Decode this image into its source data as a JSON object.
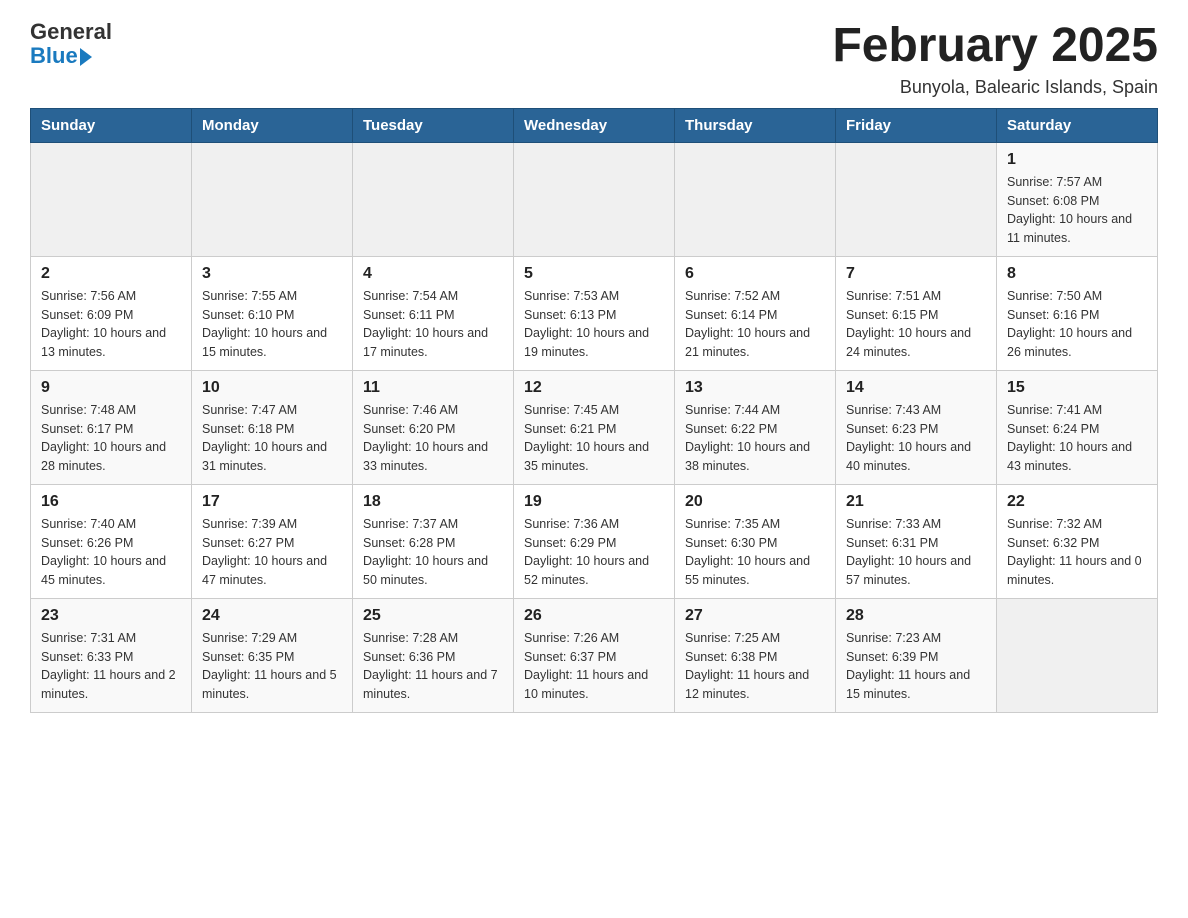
{
  "header": {
    "logo_general": "General",
    "logo_blue": "Blue",
    "month_title": "February 2025",
    "location": "Bunyola, Balearic Islands, Spain"
  },
  "days_of_week": [
    "Sunday",
    "Monday",
    "Tuesday",
    "Wednesday",
    "Thursday",
    "Friday",
    "Saturday"
  ],
  "weeks": [
    {
      "days": [
        {
          "number": "",
          "info": ""
        },
        {
          "number": "",
          "info": ""
        },
        {
          "number": "",
          "info": ""
        },
        {
          "number": "",
          "info": ""
        },
        {
          "number": "",
          "info": ""
        },
        {
          "number": "",
          "info": ""
        },
        {
          "number": "1",
          "info": "Sunrise: 7:57 AM\nSunset: 6:08 PM\nDaylight: 10 hours and 11 minutes."
        }
      ]
    },
    {
      "days": [
        {
          "number": "2",
          "info": "Sunrise: 7:56 AM\nSunset: 6:09 PM\nDaylight: 10 hours and 13 minutes."
        },
        {
          "number": "3",
          "info": "Sunrise: 7:55 AM\nSunset: 6:10 PM\nDaylight: 10 hours and 15 minutes."
        },
        {
          "number": "4",
          "info": "Sunrise: 7:54 AM\nSunset: 6:11 PM\nDaylight: 10 hours and 17 minutes."
        },
        {
          "number": "5",
          "info": "Sunrise: 7:53 AM\nSunset: 6:13 PM\nDaylight: 10 hours and 19 minutes."
        },
        {
          "number": "6",
          "info": "Sunrise: 7:52 AM\nSunset: 6:14 PM\nDaylight: 10 hours and 21 minutes."
        },
        {
          "number": "7",
          "info": "Sunrise: 7:51 AM\nSunset: 6:15 PM\nDaylight: 10 hours and 24 minutes."
        },
        {
          "number": "8",
          "info": "Sunrise: 7:50 AM\nSunset: 6:16 PM\nDaylight: 10 hours and 26 minutes."
        }
      ]
    },
    {
      "days": [
        {
          "number": "9",
          "info": "Sunrise: 7:48 AM\nSunset: 6:17 PM\nDaylight: 10 hours and 28 minutes."
        },
        {
          "number": "10",
          "info": "Sunrise: 7:47 AM\nSunset: 6:18 PM\nDaylight: 10 hours and 31 minutes."
        },
        {
          "number": "11",
          "info": "Sunrise: 7:46 AM\nSunset: 6:20 PM\nDaylight: 10 hours and 33 minutes."
        },
        {
          "number": "12",
          "info": "Sunrise: 7:45 AM\nSunset: 6:21 PM\nDaylight: 10 hours and 35 minutes."
        },
        {
          "number": "13",
          "info": "Sunrise: 7:44 AM\nSunset: 6:22 PM\nDaylight: 10 hours and 38 minutes."
        },
        {
          "number": "14",
          "info": "Sunrise: 7:43 AM\nSunset: 6:23 PM\nDaylight: 10 hours and 40 minutes."
        },
        {
          "number": "15",
          "info": "Sunrise: 7:41 AM\nSunset: 6:24 PM\nDaylight: 10 hours and 43 minutes."
        }
      ]
    },
    {
      "days": [
        {
          "number": "16",
          "info": "Sunrise: 7:40 AM\nSunset: 6:26 PM\nDaylight: 10 hours and 45 minutes."
        },
        {
          "number": "17",
          "info": "Sunrise: 7:39 AM\nSunset: 6:27 PM\nDaylight: 10 hours and 47 minutes."
        },
        {
          "number": "18",
          "info": "Sunrise: 7:37 AM\nSunset: 6:28 PM\nDaylight: 10 hours and 50 minutes."
        },
        {
          "number": "19",
          "info": "Sunrise: 7:36 AM\nSunset: 6:29 PM\nDaylight: 10 hours and 52 minutes."
        },
        {
          "number": "20",
          "info": "Sunrise: 7:35 AM\nSunset: 6:30 PM\nDaylight: 10 hours and 55 minutes."
        },
        {
          "number": "21",
          "info": "Sunrise: 7:33 AM\nSunset: 6:31 PM\nDaylight: 10 hours and 57 minutes."
        },
        {
          "number": "22",
          "info": "Sunrise: 7:32 AM\nSunset: 6:32 PM\nDaylight: 11 hours and 0 minutes."
        }
      ]
    },
    {
      "days": [
        {
          "number": "23",
          "info": "Sunrise: 7:31 AM\nSunset: 6:33 PM\nDaylight: 11 hours and 2 minutes."
        },
        {
          "number": "24",
          "info": "Sunrise: 7:29 AM\nSunset: 6:35 PM\nDaylight: 11 hours and 5 minutes."
        },
        {
          "number": "25",
          "info": "Sunrise: 7:28 AM\nSunset: 6:36 PM\nDaylight: 11 hours and 7 minutes."
        },
        {
          "number": "26",
          "info": "Sunrise: 7:26 AM\nSunset: 6:37 PM\nDaylight: 11 hours and 10 minutes."
        },
        {
          "number": "27",
          "info": "Sunrise: 7:25 AM\nSunset: 6:38 PM\nDaylight: 11 hours and 12 minutes."
        },
        {
          "number": "28",
          "info": "Sunrise: 7:23 AM\nSunset: 6:39 PM\nDaylight: 11 hours and 15 minutes."
        },
        {
          "number": "",
          "info": ""
        }
      ]
    }
  ]
}
